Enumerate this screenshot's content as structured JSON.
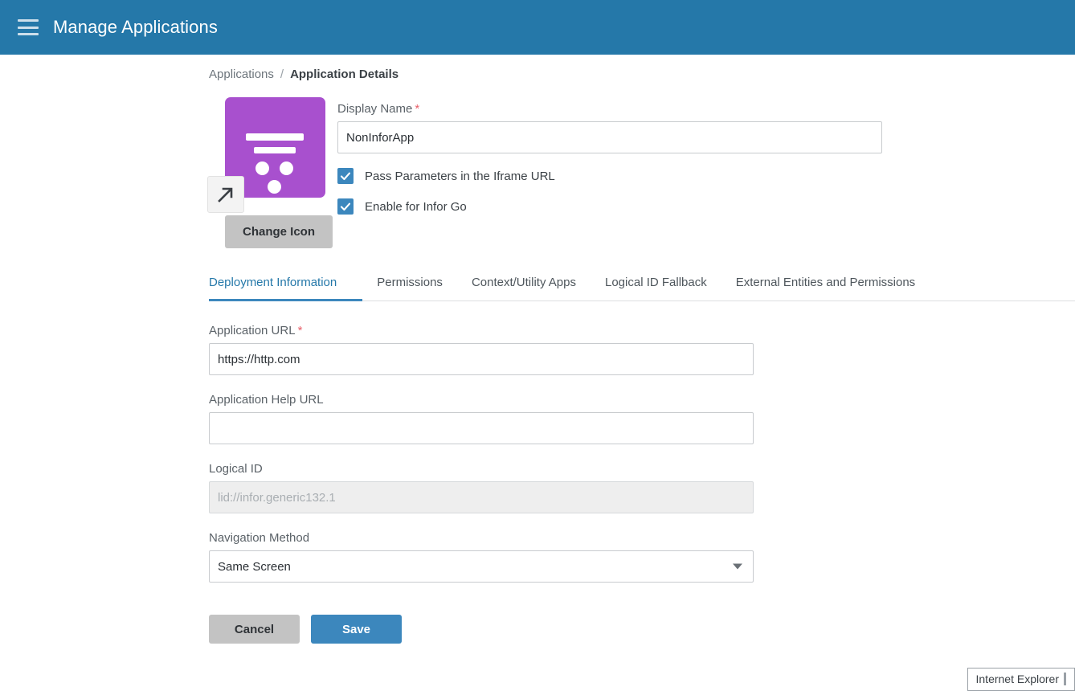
{
  "appbar": {
    "menu_icon": "hamburger-menu-icon",
    "title": "Manage Applications",
    "background": "#2578A9"
  },
  "breadcrumb": {
    "parent": "Applications",
    "separator": "/",
    "current": "Application Details"
  },
  "app_icon": {
    "name": "application-tile-icon",
    "color": "#A850CE",
    "badge_icon": "external-link-arrow-icon"
  },
  "buttons": {
    "change_icon": "Change Icon",
    "cancel": "Cancel",
    "save": "Save"
  },
  "display_name": {
    "label": "Display Name",
    "required_marker": "*",
    "value": "NonInforApp",
    "placeholder": ""
  },
  "checkboxes": [
    {
      "label": "Pass Parameters in the Iframe URL",
      "checked": true
    },
    {
      "label": "Enable for Infor Go",
      "checked": true
    }
  ],
  "tabs": [
    {
      "label": "Deployment Information",
      "active": true
    },
    {
      "label": "Permissions",
      "active": false
    },
    {
      "label": "Context/Utility Apps",
      "active": false
    },
    {
      "label": "Logical ID Fallback",
      "active": false
    },
    {
      "label": "External Entities and Permissions",
      "active": false
    }
  ],
  "deployment": {
    "application_url": {
      "label": "Application URL",
      "required_marker": "*",
      "value": "https://http.com",
      "placeholder": ""
    },
    "application_help_url": {
      "label": "Application Help URL",
      "value": "",
      "placeholder": ""
    },
    "logical_id": {
      "label": "Logical ID",
      "value": "",
      "placeholder": "lid://infor.generic132.1",
      "disabled": true
    },
    "navigation_method": {
      "label": "Navigation Method",
      "value": "Same Screen"
    }
  },
  "taskbar": {
    "label": "Internet Explorer"
  },
  "colors": {
    "header_blue": "#2578A9",
    "accent_blue": "#3C87BD",
    "purple": "#A850CE",
    "required_red": "#e8606a",
    "button_gray": "#c3c3c3"
  }
}
